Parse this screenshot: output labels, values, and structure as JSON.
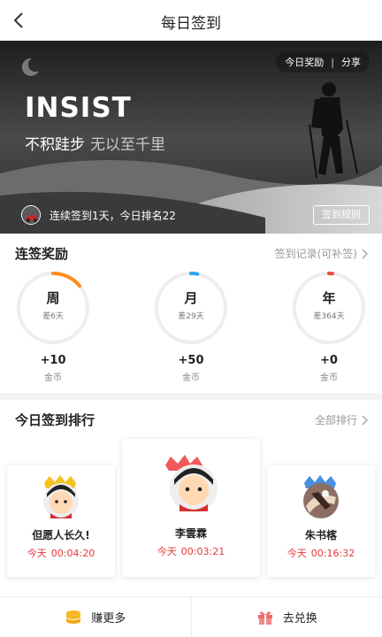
{
  "header": {
    "title": "每日签到"
  },
  "banner": {
    "rewards_link": "今日奖励",
    "separator": "|",
    "share_link": "分享",
    "headline": "INSIST",
    "slogan_main": "不积跬步",
    "slogan_sub": "无以至千里",
    "status_text": "连续签到1天，今日排名22",
    "rules_button": "签到规则"
  },
  "streak": {
    "title": "连签奖励",
    "link": "签到记录(可补签)",
    "items": [
      {
        "label": "周",
        "remaining": "差6天",
        "bonus": "+10",
        "unit": "金币",
        "progress": 0.14,
        "color": "#ff8c1a"
      },
      {
        "label": "月",
        "remaining": "差29天",
        "bonus": "+50",
        "unit": "金币",
        "progress": 0.03,
        "color": "#2aa7f5"
      },
      {
        "label": "年",
        "remaining": "差364天",
        "bonus": "+0",
        "unit": "金币",
        "progress": 0.003,
        "color": "#f0463c"
      }
    ]
  },
  "ranking": {
    "title": "今日签到排行",
    "link": "全部排行",
    "entries": [
      {
        "name": "但愿人长久!",
        "day": "今天",
        "time": "00:04:20"
      },
      {
        "name": "李雲霖",
        "day": "今天",
        "time": "00:03:21"
      },
      {
        "name": "朱书楁",
        "day": "今天",
        "time": "00:16:32"
      }
    ]
  },
  "bottom": {
    "earn": "赚更多",
    "redeem": "去兑换"
  }
}
